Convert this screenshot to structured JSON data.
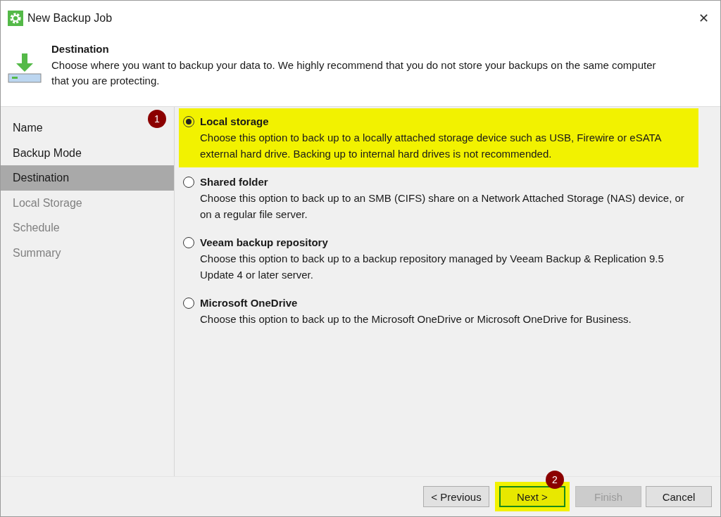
{
  "window": {
    "title": "New Backup Job",
    "close": "✕"
  },
  "header": {
    "title": "Destination",
    "description": "Choose where you want to backup your data to. We highly recommend that you do not store your backups on the same computer that you are protecting."
  },
  "steps": [
    {
      "label": "Name",
      "selected": false,
      "disabled": false
    },
    {
      "label": "Backup Mode",
      "selected": false,
      "disabled": false
    },
    {
      "label": "Destination",
      "selected": true,
      "disabled": false
    },
    {
      "label": "Local Storage",
      "selected": false,
      "disabled": true
    },
    {
      "label": "Schedule",
      "selected": false,
      "disabled": true
    },
    {
      "label": "Summary",
      "selected": false,
      "disabled": true
    }
  ],
  "options": [
    {
      "title": "Local storage",
      "description": "Choose this option to back up to a locally attached storage device such as USB, Firewire or eSATA external hard drive. Backing up to internal hard drives is not recommended.",
      "selected": true,
      "highlighted": true,
      "callout": "1"
    },
    {
      "title": "Shared folder",
      "description": "Choose this option to back up to an SMB (CIFS) share on a Network Attached Storage (NAS) device, or on a regular file server.",
      "selected": false,
      "highlighted": false
    },
    {
      "title": "Veeam backup repository",
      "description": "Choose this option to back up to a backup repository managed by Veeam Backup & Replication 9.5 Update 4 or later server.",
      "selected": false,
      "highlighted": false
    },
    {
      "title": "Microsoft OneDrive",
      "description": "Choose this option to back up to the Microsoft OneDrive or Microsoft OneDrive for Business.",
      "selected": false,
      "highlighted": false
    }
  ],
  "buttons": [
    {
      "label": "< Previous",
      "disabled": false,
      "highlighted": false
    },
    {
      "label": "Next >",
      "disabled": false,
      "highlighted": true,
      "callout": "2"
    },
    {
      "label": "Finish",
      "disabled": true,
      "highlighted": false
    },
    {
      "label": "Cancel",
      "disabled": false,
      "highlighted": false
    }
  ]
}
